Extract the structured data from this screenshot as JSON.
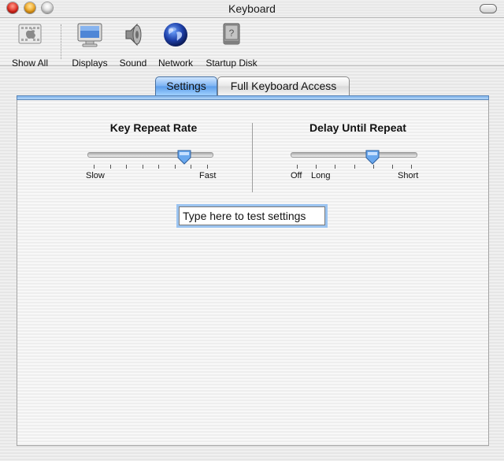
{
  "window": {
    "title": "Keyboard"
  },
  "toolbar": {
    "items": [
      {
        "label": "Show All"
      },
      {
        "label": "Displays"
      },
      {
        "label": "Sound"
      },
      {
        "label": "Network"
      },
      {
        "label": "Startup Disk"
      }
    ]
  },
  "tabs": [
    {
      "label": "Settings",
      "selected": true
    },
    {
      "label": "Full Keyboard Access",
      "selected": false
    }
  ],
  "key_repeat": {
    "title": "Key Repeat Rate",
    "min_label": "Slow",
    "max_label": "Fast",
    "value_fraction": 0.8,
    "tick_count": 8
  },
  "delay_until_repeat": {
    "title": "Delay Until Repeat",
    "labels": [
      "Off",
      "Long",
      "Short"
    ],
    "value_fraction": 0.66,
    "tick_count": 7
  },
  "test_field": {
    "value": "Type here to test settings"
  },
  "colors": {
    "accent": "#5b9ce9",
    "focus_ring": "#9cc4f0"
  },
  "icons": [
    "apple-icon",
    "display-icon",
    "speaker-icon",
    "globe-icon",
    "hard-disk-icon"
  ]
}
